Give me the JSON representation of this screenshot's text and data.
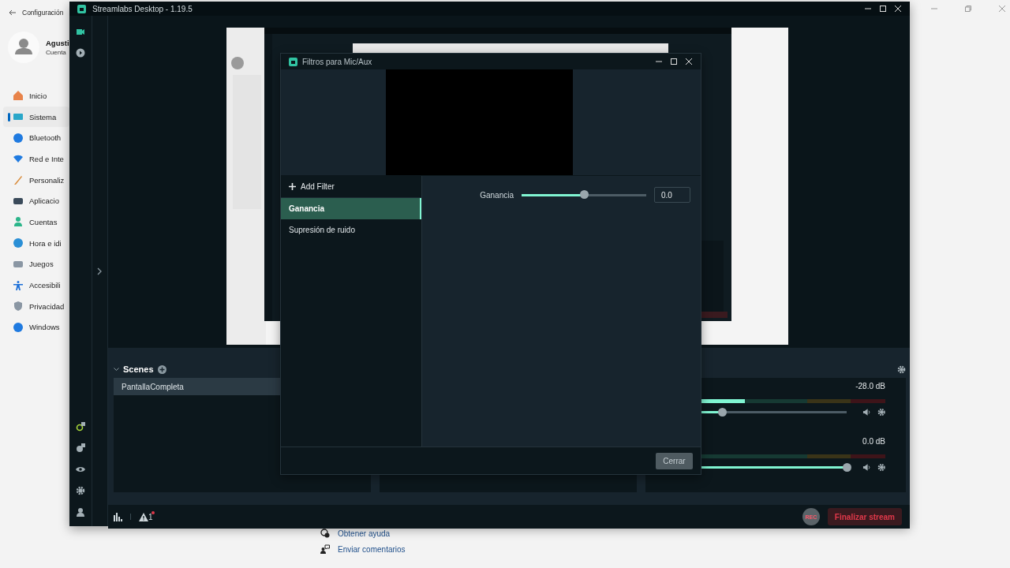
{
  "settings_window": {
    "title": "Configuración",
    "user_name": "Agusti",
    "account_label": "Cuenta",
    "nav": [
      {
        "label": "Inicio",
        "selected": false
      },
      {
        "label": "Sistema",
        "selected": true
      },
      {
        "label": "Bluetooth",
        "selected": false
      },
      {
        "label": "Red e Inte",
        "selected": false
      },
      {
        "label": "Personaliz",
        "selected": false
      },
      {
        "label": "Aplicacio",
        "selected": false
      },
      {
        "label": "Cuentas",
        "selected": false
      },
      {
        "label": "Hora e idi",
        "selected": false
      },
      {
        "label": "Juegos",
        "selected": false
      },
      {
        "label": "Accesibili",
        "selected": false
      },
      {
        "label": "Privacidad",
        "selected": false
      },
      {
        "label": "Windows",
        "selected": false
      }
    ],
    "links": [
      {
        "label": "Obtener ayuda"
      },
      {
        "label": "Enviar comentarios"
      }
    ]
  },
  "app_window": {
    "title": "Streamlabs Desktop - 1.19.5",
    "side_nav": [
      {
        "selected": true
      },
      {
        "selected": false
      }
    ],
    "scenes": {
      "title": "Scenes",
      "items": [
        {
          "label": "PantallaCompleta",
          "selected": true
        }
      ]
    },
    "mixer": {
      "channels": [
        {
          "reading": "-28.0 dB",
          "meter": {
            "level": 0.39
          },
          "volume": {
            "level": 0.35
          }
        },
        {
          "reading": "0.0 dB",
          "meter": {
            "level": 0
          },
          "volume": {
            "level": 1
          }
        }
      ]
    },
    "status_bar": {
      "alert_count": "1",
      "rec_label": "REC",
      "end_button": "Finalizar stream"
    }
  },
  "dialog": {
    "title": "Filtros para Mic/Aux",
    "add_filter": "Add Filter",
    "filters": [
      {
        "label": "Ganancia",
        "selected": true
      },
      {
        "label": "Supresión de ruido",
        "selected": false
      }
    ],
    "property": {
      "label": "Ganancia",
      "level": 0.5,
      "value": "0.0"
    },
    "close_button": "Cerrar"
  }
}
